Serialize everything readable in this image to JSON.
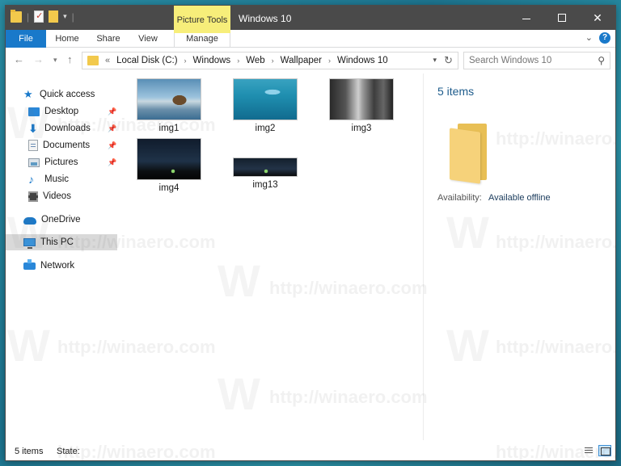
{
  "titlebar": {
    "contextual_tab": "Picture Tools",
    "title": "Windows 10"
  },
  "ribbon": {
    "tabs": [
      {
        "label": "File"
      },
      {
        "label": "Home"
      },
      {
        "label": "Share"
      },
      {
        "label": "View"
      },
      {
        "label": "Manage"
      }
    ],
    "help": "?"
  },
  "address": {
    "overflow": "«",
    "crumbs": [
      "Local Disk (C:)",
      "Windows",
      "Web",
      "Wallpaper",
      "Windows 10"
    ]
  },
  "search": {
    "placeholder": "Search Windows 10"
  },
  "navpane": {
    "quick_access": "Quick access",
    "items": [
      {
        "label": "Desktop",
        "icon": "desktop-icon"
      },
      {
        "label": "Downloads",
        "icon": "download-icon"
      },
      {
        "label": "Documents",
        "icon": "documents-icon"
      },
      {
        "label": "Pictures",
        "icon": "pictures-icon"
      },
      {
        "label": "Music",
        "icon": "music-icon"
      },
      {
        "label": "Videos",
        "icon": "videos-icon"
      }
    ],
    "onedrive": "OneDrive",
    "this_pc": "This PC",
    "network": "Network"
  },
  "files": [
    {
      "name": "img1"
    },
    {
      "name": "img2"
    },
    {
      "name": "img3"
    },
    {
      "name": "img4"
    },
    {
      "name": "img13"
    }
  ],
  "details": {
    "count": "5 items",
    "availability_label": "Availability:",
    "availability_value": "Available offline"
  },
  "status": {
    "count": "5 items",
    "state": "State:"
  },
  "watermark": {
    "text": "http://winaero.com",
    "letter": "W"
  },
  "colors": {
    "accent": "#1979ca",
    "contextual_tab": "#f7ee7a",
    "titlebar": "#4a4a4a"
  }
}
